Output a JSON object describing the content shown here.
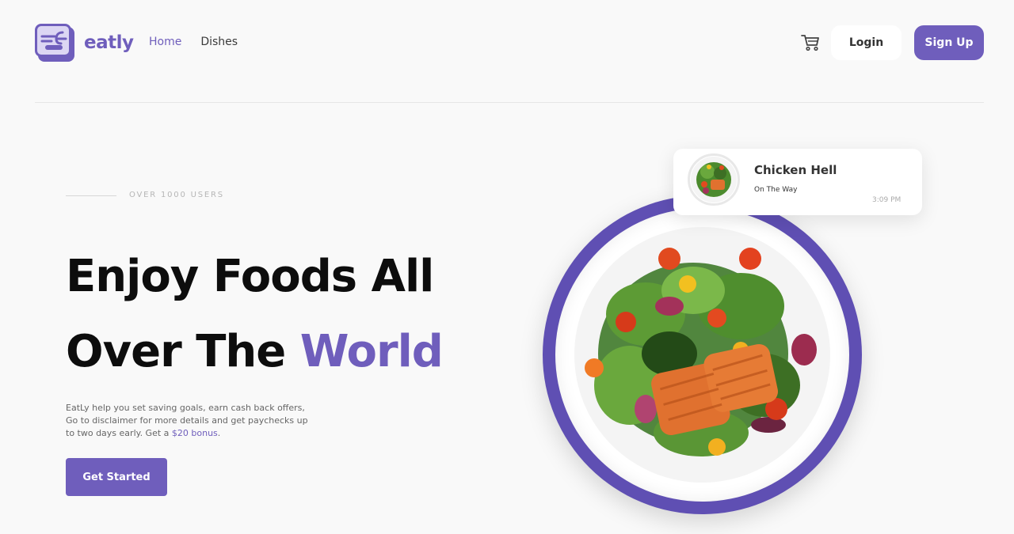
{
  "brand": {
    "name": "eatly",
    "accent_color": "#6f5ebc"
  },
  "nav": {
    "items": [
      {
        "label": "Home",
        "active": true
      },
      {
        "label": "Dishes",
        "active": false
      }
    ]
  },
  "header": {
    "cart_icon": "cart-icon",
    "login_label": "Login",
    "signup_label": "Sign Up"
  },
  "hero": {
    "users_label": "OVER 1000 USERS",
    "headline_line1": "Enjoy Foods All",
    "headline_line2_prefix": "Over The ",
    "headline_line2_accent": "World",
    "description": "EatLy help you set saving goals, earn cash back offers, Go to disclaimer for more details and get paychecks up to two days early. Get a ",
    "description_link": "$20 bonus",
    "description_end": ".",
    "cta_label": "Get Started"
  },
  "order_card": {
    "title": "Chicken Hell",
    "status": "On The Way",
    "time": "3:09 PM"
  }
}
